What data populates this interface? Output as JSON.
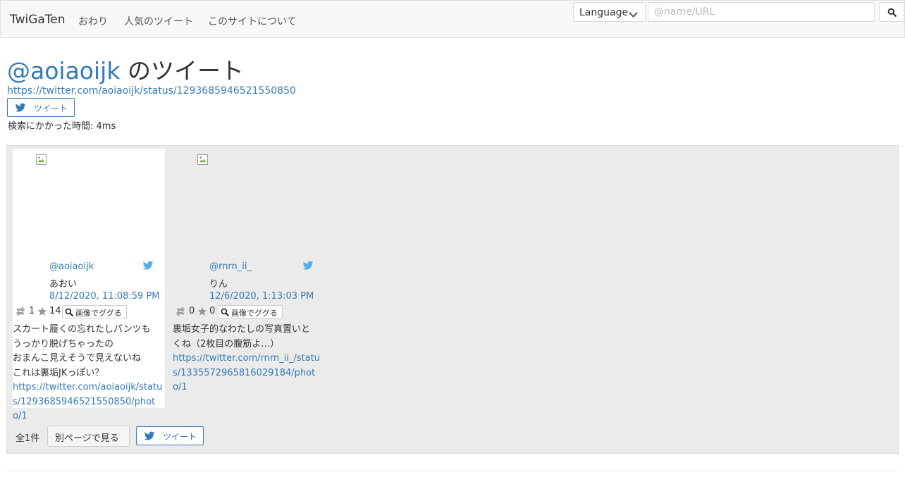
{
  "navbar": {
    "brand": "TwiGaTen",
    "links": [
      "おわり",
      "人気のツイート",
      "このサイトについて"
    ],
    "language_label": "Language",
    "search_placeholder": "@name/URL",
    "search_value": ""
  },
  "header": {
    "handle": "@aoiaoijk",
    "title_suffix": " のツイート",
    "status_url": "https://twitter.com/aoiaoijk/status/1293685946521550850",
    "tweet_button": "ツイート",
    "search_time": "検索にかかった時間: 4ms"
  },
  "results": {
    "cards": [
      {
        "user": "@aoiaoijk",
        "name": "あおい",
        "date": "8/12/2020, 11:08:59 PM",
        "retweets": "1",
        "likes": "14",
        "google_button": "画像でググる",
        "lines": [
          "スカート履くの忘れたしパンツも",
          "うっかり脱げちゃったの",
          "おまんこ見えそうで見えないね",
          "これは裏垢JKっぽい？"
        ],
        "photo_link": "https://twitter.com/aoiaoijk/status/1293685946521550850/photo/1"
      },
      {
        "user": "@rnrn_ii_",
        "name": "りん",
        "date": "12/6/2020, 1:13:03 PM",
        "retweets": "0",
        "likes": "0",
        "google_button": "画像でググる",
        "lines": [
          "裏垢女子的なわたしの写真置いと",
          "くね（2枚目の腹筋よ…）"
        ],
        "photo_link": "https://twitter.com/rnrn_ii_/status/1335572965816029184/photo/1"
      }
    ],
    "total": "全1件",
    "other_page_button": "別ページで見る",
    "tweet_button": "ツイート"
  },
  "colors": {
    "link": "#337ab7",
    "twitter": "#55acee",
    "panel_bg": "#ebebeb",
    "navbar_bg": "#f8f8f8"
  },
  "icons": {
    "search": "search-icon",
    "twitter": "twitter-bird-icon",
    "retweet": "retweet-icon",
    "like": "star-icon",
    "chevron": "chevron-down-icon"
  }
}
